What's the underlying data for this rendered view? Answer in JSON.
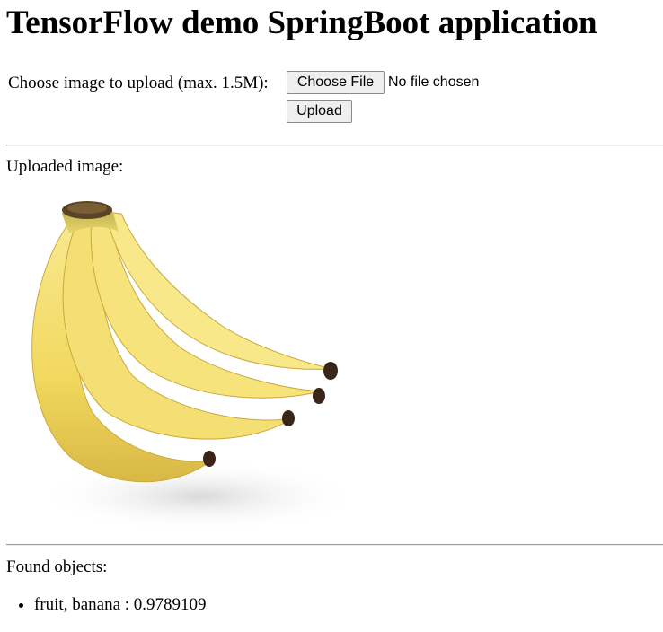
{
  "header": {
    "title": "TensorFlow demo SpringBoot application"
  },
  "upload_form": {
    "label": "Choose image to upload (max. 1.5M):",
    "choose_file_label": "Choose File",
    "file_status": "No file chosen",
    "upload_label": "Upload"
  },
  "uploaded": {
    "label": "Uploaded image:",
    "image_subject": "banana-bunch-image"
  },
  "results": {
    "label": "Found objects:",
    "items": [
      "fruit, banana : 0.9789109"
    ]
  },
  "colors": {
    "banana_yellow": "#f3dc6b",
    "banana_shadow": "#c9a93a",
    "banana_stem": "#8f8a3a",
    "banana_tip": "#3a2518"
  }
}
